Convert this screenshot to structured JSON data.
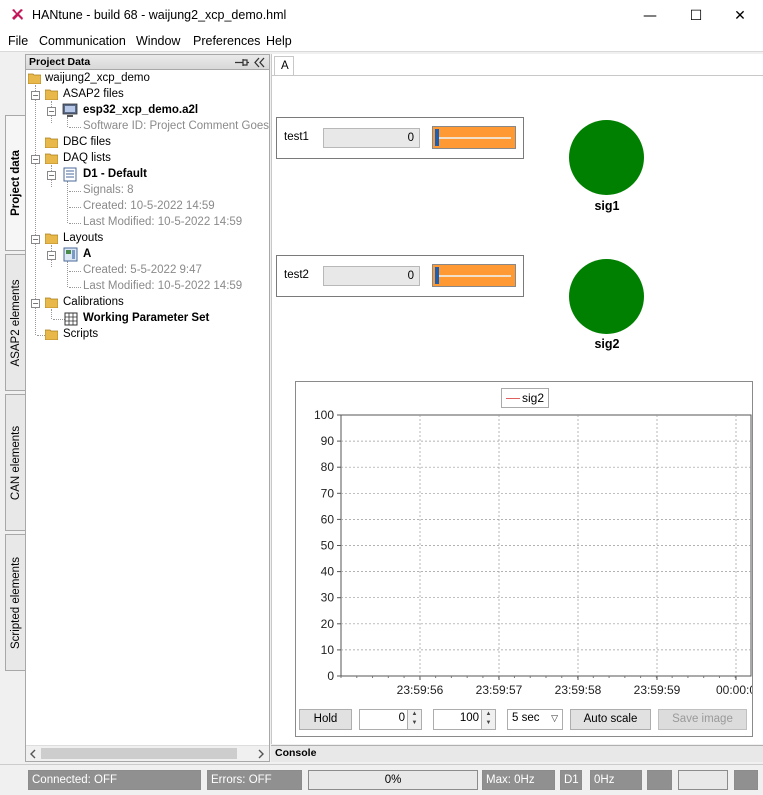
{
  "window": {
    "title": "HANtune - build 68 - waijung2_xcp_demo.hml",
    "controls": {
      "minimize": "—",
      "maximize": "☐",
      "close": "✕"
    }
  },
  "menu": [
    "File",
    "Communication",
    "Window",
    "Preferences",
    "Help"
  ],
  "side_tabs": [
    "Project data",
    "ASAP2 elements",
    "CAN elements",
    "Scripted elements"
  ],
  "project_panel": {
    "title": "Project Data",
    "tree": {
      "root": "waijung2_xcp_demo",
      "asap2_files": "ASAP2 files",
      "a2l_file": "esp32_xcp_demo.a2l",
      "software_id": "Software ID: Project Comment Goes Here",
      "dbc_files": "DBC files",
      "daq_lists": "DAQ lists",
      "daq_default": "D1 - Default",
      "daq_signals": "Signals: 8",
      "daq_created": "Created: 10-5-2022 14:59",
      "daq_modified": "Last Modified: 10-5-2022 14:59",
      "layouts": "Layouts",
      "layout_a": "A",
      "layout_created": "Created: 5-5-2022 9:47",
      "layout_modified": "Last Modified: 10-5-2022 14:59",
      "calibrations": "Calibrations",
      "param_set": "Working Parameter Set",
      "scripts": "Scripts"
    }
  },
  "layout": {
    "tab": "A",
    "params": [
      {
        "label": "test1",
        "value": "0",
        "slider_fraction": 0
      },
      {
        "label": "test2",
        "value": "0",
        "slider_fraction": 0
      }
    ],
    "leds": [
      {
        "label": "sig1",
        "color": "#008000"
      },
      {
        "label": "sig2",
        "color": "#008000"
      }
    ],
    "controls": {
      "hold": "Hold",
      "min": "0",
      "max": "100",
      "window": "5 sec",
      "auto_scale": "Auto scale",
      "save_image": "Save image"
    }
  },
  "chart_data": {
    "type": "line",
    "series": [
      {
        "name": "sig2",
        "color": "#e06060",
        "values": []
      }
    ],
    "yticks": [
      "100",
      "90",
      "80",
      "70",
      "60",
      "50",
      "40",
      "30",
      "20",
      "10",
      "0"
    ],
    "xticks": [
      "23:59:56",
      "23:59:57",
      "23:59:58",
      "23:59:59",
      "00:00:0"
    ],
    "ylim": [
      0,
      100
    ],
    "grid": true,
    "legend": "top-center"
  },
  "console": {
    "title": "Console"
  },
  "status": {
    "connected": "Connected: OFF",
    "errors": "Errors: OFF",
    "progress": "0%",
    "max_rate": "Max: 0Hz",
    "daq": "D1",
    "rate": "0Hz"
  }
}
